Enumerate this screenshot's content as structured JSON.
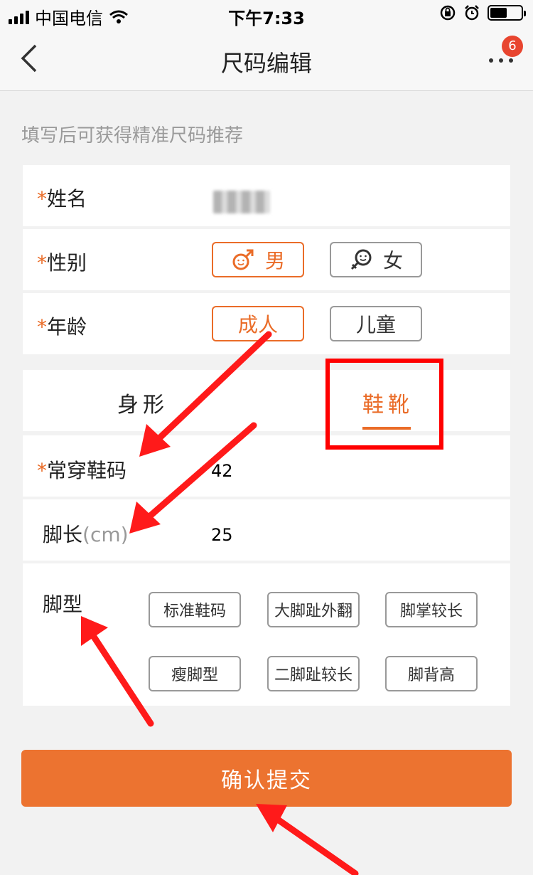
{
  "status_bar": {
    "carrier": "中国电信",
    "time": "下午7:33"
  },
  "nav": {
    "title": "尺码编辑",
    "badge_count": "6"
  },
  "hint": "填写后可获得精准尺码推荐",
  "form": {
    "required_mark": "*",
    "name_label": "姓名",
    "gender_label": "性别",
    "gender_options": [
      "男",
      "女"
    ],
    "age_label": "年龄",
    "age_options": [
      "成人",
      "儿童"
    ]
  },
  "tabs": {
    "body": "身形",
    "shoes": "鞋靴"
  },
  "shoes": {
    "size_label": "常穿鞋码",
    "size_value": "42",
    "length_label": "脚长",
    "length_unit": "(cm)",
    "length_value": "25",
    "foot_type_label": "脚型",
    "foot_types": [
      "标准鞋码",
      "大脚趾外翻",
      "脚掌较长",
      "瘦脚型",
      "二脚趾较长",
      "脚背高"
    ]
  },
  "submit_label": "确认提交",
  "colors": {
    "accent": "#ea6c28",
    "submit": "#ec7330",
    "annotation": "#ff0000",
    "badge": "#e8452f"
  }
}
